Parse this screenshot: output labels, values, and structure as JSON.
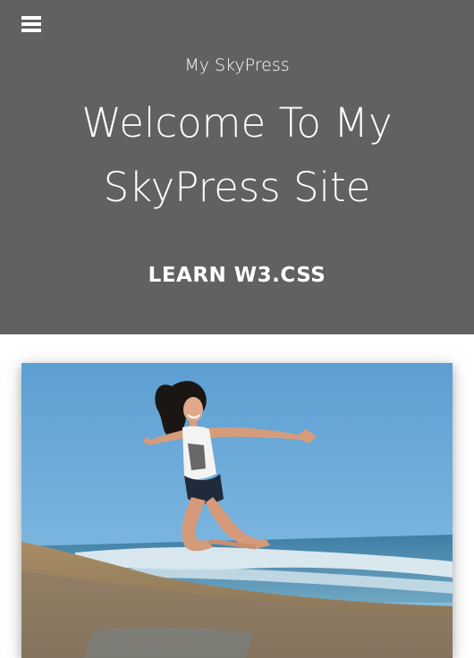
{
  "header": {
    "menu_icon": "hamburger-menu-icon",
    "site_name": "My SkyPress",
    "title_line1": "Welcome To My",
    "title_line2": "SkyPress Site",
    "cta_label": "LEARN W3.CSS",
    "background_color": "#616161",
    "text_color": "#ffffff"
  },
  "hero_image": {
    "subject": "woman-jumping-on-beach-photo"
  }
}
